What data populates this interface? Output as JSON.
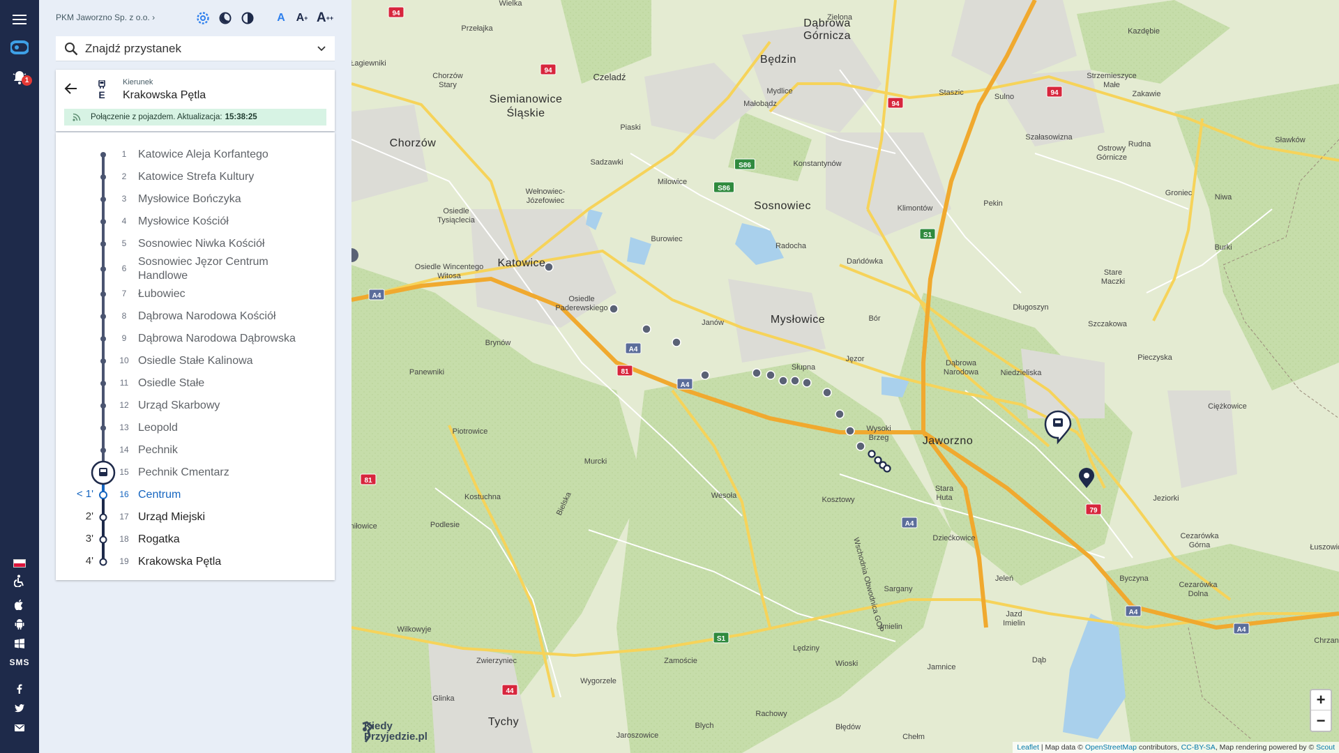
{
  "agency": {
    "name": "PKM Jaworzno Sp. z o.o.",
    "chevron": "›"
  },
  "topbar": {
    "font_small": "A",
    "font_medium": "A",
    "font_large": "A",
    "font_medium_sup": "+",
    "font_large_sup": "++"
  },
  "rail": {
    "notifications_count": "1",
    "sms_label": "SMS"
  },
  "search": {
    "placeholder": "Znajdź przystanek"
  },
  "direction": {
    "label": "Kierunek",
    "value": "Krakowska Pętla",
    "line": "E"
  },
  "status": {
    "text": "Połączenie z pojazdem. Aktualizacja:",
    "time": "15:38:25"
  },
  "stops": [
    {
      "n": "1",
      "name": "Katowice Aleja Korfantego",
      "eta": ""
    },
    {
      "n": "2",
      "name": "Katowice Strefa Kultury",
      "eta": ""
    },
    {
      "n": "3",
      "name": "Mysłowice Bończyka",
      "eta": ""
    },
    {
      "n": "4",
      "name": "Mysłowice Kościół",
      "eta": ""
    },
    {
      "n": "5",
      "name": "Sosnowiec Niwka Kościół",
      "eta": ""
    },
    {
      "n": "6",
      "name": "Sosnowiec Jęzor Centrum Handlowe",
      "eta": ""
    },
    {
      "n": "7",
      "name": "Łubowiec",
      "eta": ""
    },
    {
      "n": "8",
      "name": "Dąbrowa Narodowa Kościół",
      "eta": ""
    },
    {
      "n": "9",
      "name": "Dąbrowa Narodowa Dąbrowska",
      "eta": ""
    },
    {
      "n": "10",
      "name": "Osiedle Stałe Kalinowa",
      "eta": ""
    },
    {
      "n": "11",
      "name": "Osiedle Stałe",
      "eta": ""
    },
    {
      "n": "12",
      "name": "Urząd Skarbowy",
      "eta": ""
    },
    {
      "n": "13",
      "name": "Leopold",
      "eta": ""
    },
    {
      "n": "14",
      "name": "Pechnik",
      "eta": ""
    },
    {
      "n": "15",
      "name": "Pechnik Cmentarz",
      "eta": ""
    },
    {
      "n": "16",
      "name": "Centrum",
      "eta": "< 1'"
    },
    {
      "n": "17",
      "name": "Urząd Miejski",
      "eta": "2'"
    },
    {
      "n": "18",
      "name": "Rogatka",
      "eta": "3'"
    },
    {
      "n": "19",
      "name": "Krakowska Pętla",
      "eta": "4'"
    }
  ],
  "map": {
    "towns": {
      "dabrowa_gornicza": "Dąbrowa\nGórnicza",
      "bedzin": "Będzin",
      "siemianowice": "Siemianowice\nŚląskie",
      "chorzow": "Chorzów",
      "czeladz": "Czeladź",
      "sosnowiec": "Sosnowiec",
      "katowice": "Katowice",
      "myslowice": "Mysłowice",
      "jaworzno": "Jaworzno",
      "tychy": "Tychy"
    },
    "places": {
      "wielka": "Wielka",
      "przelajka": "Przełajka",
      "zielona": "Zielona",
      "sagiewniki": "Łagiewniki",
      "chorzow_stary": "Chorzów\nStary",
      "mydlice": "Mydlice",
      "malobadz": "Małobądz",
      "staszic": "Staszic",
      "sulno": "Sulno",
      "strzemieszyce": "Strzemieszyce\nMałe",
      "zakawie": "Zakawie",
      "kazdebie": "Kazdębie",
      "piaski": "Piaski",
      "sadzawki": "Sadzawki",
      "konstantynow": "Konstantynów",
      "szalasowizna": "Szałasowizna",
      "rudna": "Rudna",
      "slawkow": "Sławków",
      "milowice": "Milowice",
      "welnowiec": "Wełnowiec-\nJózefowiec",
      "osiedle_tysiaclecia": "Osiedle\nTysiąclecia",
      "klimontow": "Klimontów",
      "ostrowy": "Ostrowy\nGórnicze",
      "groniec": "Groniec",
      "niwa": "Niwa",
      "pekin": "Pekin",
      "burowiec": "Burowiec",
      "radocha": "Radocha",
      "burki": "Burki",
      "osiedle_wincentego": "Osiedle Wincentego\nWitosa",
      "dandowka": "Dańdówka",
      "stare_maczki": "Stare\nMaczki",
      "osiedle_paderewskiego": "Osiedle\nPaderewskiego",
      "janow": "Janów",
      "dlugoszyn": "Długoszyn",
      "bor": "Bór",
      "szczakowa": "Szczakowa",
      "brynow": "Brynów",
      "jezor": "Jęzor",
      "slupna": "Słupna",
      "pieczyska": "Pieczyska",
      "dabrowa_narodowa": "Dąbrowa\nNarodowa",
      "niedzieliska": "Niedzieliska",
      "panewniki": "Panewniki",
      "ciezkowice": "Ciężkowice",
      "wysoki_brzeg": "Wysoki\nBrzeg",
      "piotrowice": "Piotrowice",
      "stara_huta": "Stara\nHuta",
      "murcki": "Murcki",
      "jeziorki": "Jeziorki",
      "kostuchna": "Kostuchna",
      "wesola": "Wesoła",
      "kosztowy": "Kosztowy",
      "dziekowice": "Dziećkowice",
      "cezarowka_gorna": "Cezarówka\nGórna",
      "podlesie": "Podlesie",
      "bielska": "Bielska",
      "mionka": "Śmiłowice",
      "luszowice": "Łuszowice",
      "jelen": "Jeleń",
      "byczyna": "Byczyna",
      "cezarowka_dolna": "Cezarówka\nDolna",
      "sargany": "Sargany",
      "wilkowyje": "Wilkowyje",
      "imielin": "Imielin",
      "jazd": "Jazd\nImielin",
      "chrzanow": "Chrzan",
      "zamoscie": "Zamoście",
      "ledziny": "Lędziny",
      "wioski": "Wioski",
      "jamnice": "Jamnice",
      "zwierzyniec": "Zwierzyniec",
      "wygorzele": "Wygorzele",
      "dab": "Dąb",
      "glinka": "Glinka",
      "rachowy": "Rachowy",
      "blycin": "Blych",
      "bledow": "Błędów",
      "jaroszowice": "Jaroszowice",
      "chelm": "Chełm",
      "wschodnia": "Wschodnia Obwodnica GOP"
    },
    "shields": {
      "r94": "94",
      "r86": "S86",
      "r1": "S1",
      "a4": "A4",
      "r81": "81",
      "r79": "79",
      "r44": "44"
    }
  },
  "brand": {
    "line1": "Kiedy",
    "line2": "Przyjedzie.pl"
  },
  "zoom": {
    "in": "+",
    "out": "−"
  },
  "attribution": {
    "leaflet": "Leaflet",
    "sep": " | Map data © ",
    "osm": "OpenStreetMap",
    "contrib": " contributors, ",
    "ccbysa": "CC-BY-SA",
    "render": ", Map rendering powered by © ",
    "scout": "Scout"
  },
  "colors": {
    "rail": "#1e2a4a",
    "route": "#3f4a6b",
    "current": "#1565c0",
    "status_bg": "#d7f3e4"
  }
}
